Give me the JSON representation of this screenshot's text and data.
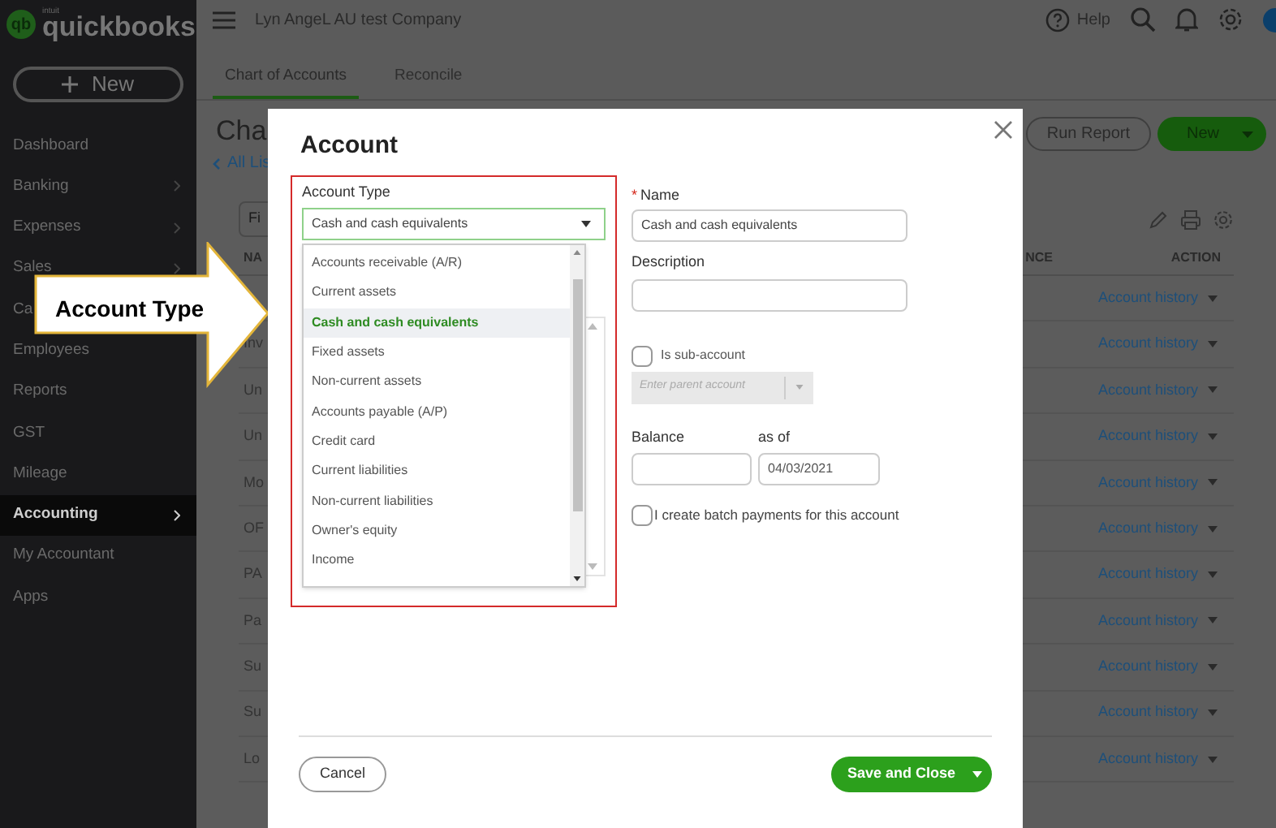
{
  "app": {
    "logo_small": "intuit",
    "logo": "quickbooks",
    "logo_mark": "qb"
  },
  "sidebar": {
    "new_button": "New",
    "items": [
      {
        "label": "Dashboard",
        "selected": false,
        "submenu": false
      },
      {
        "label": "Banking",
        "selected": false,
        "submenu": true
      },
      {
        "label": "Expenses",
        "selected": false,
        "submenu": true
      },
      {
        "label": "Sales",
        "selected": false,
        "submenu": true
      },
      {
        "label": "Ca",
        "selected": false,
        "submenu": false
      },
      {
        "label": "Employees",
        "selected": false,
        "submenu": false
      },
      {
        "label": "Reports",
        "selected": false,
        "submenu": false
      },
      {
        "label": "GST",
        "selected": false,
        "submenu": false
      },
      {
        "label": "Mileage",
        "selected": false,
        "submenu": false
      },
      {
        "label": "Accounting",
        "selected": true,
        "submenu": true
      },
      {
        "label": "My Accountant",
        "selected": false,
        "submenu": false
      },
      {
        "label": "Apps",
        "selected": false,
        "submenu": false
      }
    ]
  },
  "header": {
    "company": "Lyn AngeL AU test Company",
    "help": "Help"
  },
  "tabs": [
    {
      "label": "Chart of Accounts",
      "selected": true
    },
    {
      "label": "Reconcile",
      "selected": false
    }
  ],
  "page": {
    "title": "Cha",
    "back_link": "All Lis",
    "filter_placeholder": "Fi",
    "run_report": "Run Report",
    "new_button": "New",
    "columns": [
      "NA",
      "NCE",
      "ACTION"
    ],
    "rows": [
      {
        "action": "Account history"
      },
      {
        "name": "Inv",
        "action": "Account history"
      },
      {
        "name": "Un",
        "action": "Account history"
      },
      {
        "name": "Un",
        "action": "Account history"
      },
      {
        "name": "Mo",
        "action": "Account history"
      },
      {
        "name": "OF",
        "action": "Account history"
      },
      {
        "name": "PA",
        "action": "Account history"
      },
      {
        "name": "Pa",
        "action": "Account history"
      },
      {
        "name": "Su",
        "action": "Account history"
      },
      {
        "name": "Su",
        "action": "Account history"
      },
      {
        "name": "Lo",
        "action": "Account history"
      }
    ]
  },
  "callout": {
    "text": "Account Type"
  },
  "dialog": {
    "title": "Account",
    "account_type": {
      "label": "Account Type",
      "value": "Cash and cash equivalents",
      "options": [
        {
          "label": "Accounts receivable (A/R)",
          "selected": false
        },
        {
          "label": "Current assets",
          "selected": false
        },
        {
          "label": "Cash and cash equivalents",
          "selected": true
        },
        {
          "label": "Fixed assets",
          "selected": false
        },
        {
          "label": "Non-current assets",
          "selected": false
        },
        {
          "label": "Accounts payable (A/P)",
          "selected": false
        },
        {
          "label": "Credit card",
          "selected": false
        },
        {
          "label": "Current liabilities",
          "selected": false
        },
        {
          "label": "Non-current liabilities",
          "selected": false
        },
        {
          "label": "Owner's equity",
          "selected": false
        },
        {
          "label": "Income",
          "selected": false
        }
      ]
    },
    "name": {
      "label": "Name",
      "required_mark": "*",
      "value": "Cash and cash equivalents"
    },
    "description": {
      "label": "Description"
    },
    "sub_account": {
      "label": "Is sub-account",
      "checked": false,
      "placeholder": "Enter parent account"
    },
    "balance": {
      "label": "Balance"
    },
    "as_of": {
      "label": "as of",
      "value": "04/03/2021"
    },
    "batch_payments": {
      "label": "I create batch payments for this account",
      "checked": false
    },
    "cancel": "Cancel",
    "save": "Save and Close"
  }
}
